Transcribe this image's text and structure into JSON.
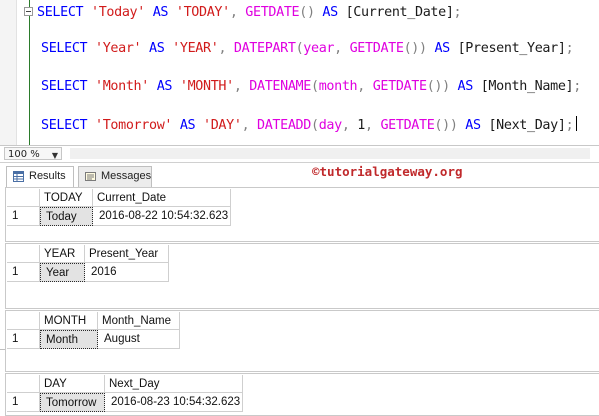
{
  "editor": {
    "lines": [
      {
        "kw1": "SELECT",
        "str1": "'Today'",
        "kw2": "AS",
        "str2": "'TODAY'",
        "sep": ",",
        "fn": "GETDATE",
        "args": "()",
        "kw3": "AS",
        "alias": "[Current_Date]",
        "end": ";"
      },
      {
        "kw1": "SELECT",
        "str1": "'Year'",
        "kw2": "AS",
        "str2": "'YEAR'",
        "sep": ",",
        "fn": "DATEPART",
        "open": "(",
        "a1": "year",
        "c1": ",",
        "fn2": "GETDATE",
        "close": "())",
        "kw3": "AS",
        "alias": "[Present_Year]",
        "end": ";"
      },
      {
        "kw1": "SELECT",
        "str1": "'Month'",
        "kw2": "AS",
        "str2": "'MONTH'",
        "sep": ",",
        "fn": "DATENAME",
        "open": "(",
        "a1": "month",
        "c1": ",",
        "fn2": "GETDATE",
        "close": "())",
        "kw3": "AS",
        "alias": "[Month_Name]",
        "end": ";"
      },
      {
        "kw1": "SELECT",
        "str1": "'Tomorrow'",
        "kw2": "AS",
        "str2": "'DAY'",
        "sep": ",",
        "fn": "DATEADD",
        "open": "(",
        "a1": "day",
        "c1": ",",
        "a2": "1",
        "c2": ",",
        "fn2": "GETDATE",
        "close": "())",
        "kw3": "AS",
        "alias": "[Next_Day]",
        "end": ";"
      }
    ]
  },
  "zoom": {
    "value": "100 %"
  },
  "tabs": {
    "results": "Results",
    "messages": "Messages"
  },
  "watermark": "©tutorialgateway.org",
  "grids": [
    {
      "headers": [
        "TODAY",
        "Current_Date"
      ],
      "row_number": "1",
      "values": [
        "Today",
        "2016-08-22 10:54:32.623"
      ]
    },
    {
      "headers": [
        "YEAR",
        "Present_Year"
      ],
      "row_number": "1",
      "values": [
        "Year",
        "2016"
      ]
    },
    {
      "headers": [
        "MONTH",
        "Month_Name"
      ],
      "row_number": "1",
      "values": [
        "Month",
        "August"
      ]
    },
    {
      "headers": [
        "DAY",
        "Next_Day"
      ],
      "row_number": "1",
      "values": [
        "Tomorrow",
        "2016-08-23 10:54:32.623"
      ]
    }
  ],
  "colors": {
    "keyword": "#0000ff",
    "string": "#d11b1b",
    "function": "#e000e0",
    "watermark": "#c0292b",
    "selected_cell": "#e3e3e3"
  },
  "icons": {
    "results_tab": "grid-icon",
    "messages_tab": "message-icon",
    "fold": "collapse-icon"
  }
}
